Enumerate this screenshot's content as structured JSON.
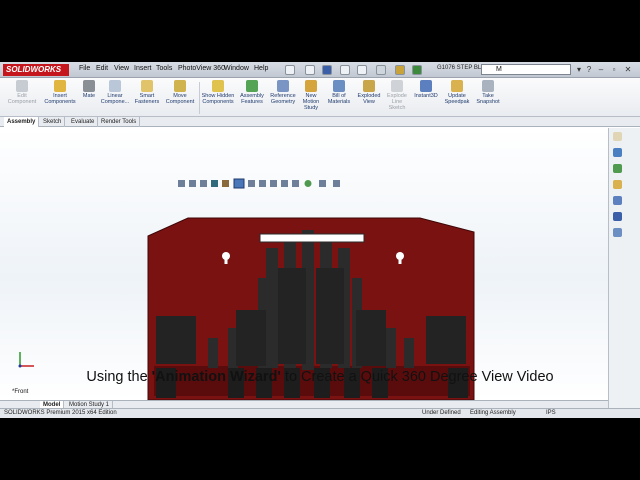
{
  "app": {
    "logo_text": "SOLIDWORKS",
    "document_title": "G1076 STEP BL...",
    "search_value": "M"
  },
  "menu": [
    "File",
    "Edit",
    "View",
    "Insert",
    "Tools",
    "PhotoView 360",
    "Window",
    "Help"
  ],
  "toolbar": {
    "tools": [
      {
        "label": "Edit Component",
        "icon": "edit-component-icon",
        "enabled": false
      },
      {
        "label": "Insert Components",
        "icon": "insert-components-icon",
        "enabled": true
      },
      {
        "label": "Mate",
        "icon": "mate-icon",
        "enabled": true
      },
      {
        "label": "Linear Compone...",
        "icon": "linear-pattern-icon",
        "enabled": true
      },
      {
        "label": "Smart Fasteners",
        "icon": "smart-fasteners-icon",
        "enabled": true
      },
      {
        "label": "Move Component",
        "icon": "move-component-icon",
        "enabled": true
      },
      {
        "label": "Show Hidden Components",
        "icon": "show-hidden-icon",
        "enabled": true
      },
      {
        "label": "Assembly Features",
        "icon": "assembly-features-icon",
        "enabled": true
      },
      {
        "label": "Reference Geometry",
        "icon": "reference-geometry-icon",
        "enabled": true
      },
      {
        "label": "New Motion Study",
        "icon": "motion-study-icon",
        "enabled": true
      },
      {
        "label": "Bill of Materials",
        "icon": "bom-icon",
        "enabled": true
      },
      {
        "label": "Exploded View",
        "icon": "exploded-view-icon",
        "enabled": true
      },
      {
        "label": "Explode Line Sketch",
        "icon": "explode-line-icon",
        "enabled": false
      },
      {
        "label": "Instant3D",
        "icon": "instant3d-icon",
        "enabled": true
      },
      {
        "label": "Update Speedpak",
        "icon": "speedpak-icon",
        "enabled": true
      },
      {
        "label": "Take Snapshot",
        "icon": "snapshot-icon",
        "enabled": true
      }
    ]
  },
  "tabs": [
    "Assembly",
    "Sketch",
    "Evaluate",
    "Render Tools"
  ],
  "view": {
    "orientation_label": "*Front",
    "caption_pre": "Using the ",
    "caption_quote": "'Animation Wizard'",
    "caption_post": " to Create a Quick 360 Degree View Video"
  },
  "bottom_tabs": [
    "Model",
    "Motion Study 1"
  ],
  "status": {
    "edition": "SOLIDWORKS Premium 2015 x64 Edition",
    "state": "Under Defined",
    "mode": "Editing Assembly",
    "units": "IPS"
  },
  "colors": {
    "plate": "#7a1212",
    "plate_dark": "#5a0c0c",
    "part": "#2b2b2b"
  }
}
